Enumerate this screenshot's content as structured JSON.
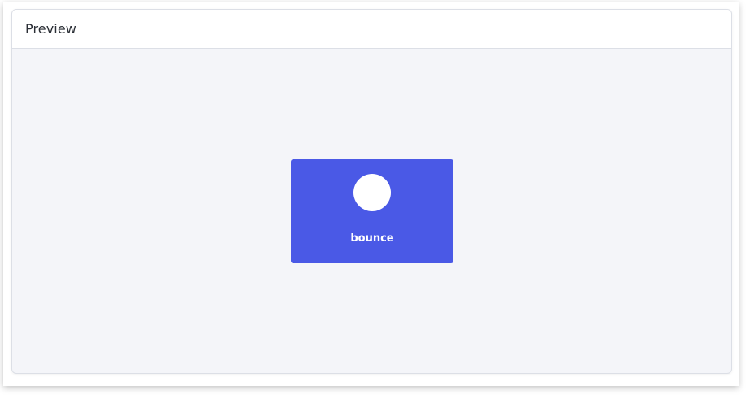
{
  "panel": {
    "title": "Preview"
  },
  "demo": {
    "label": "bounce",
    "accent_color": "#4a59e6",
    "ball_color": "#ffffff"
  }
}
